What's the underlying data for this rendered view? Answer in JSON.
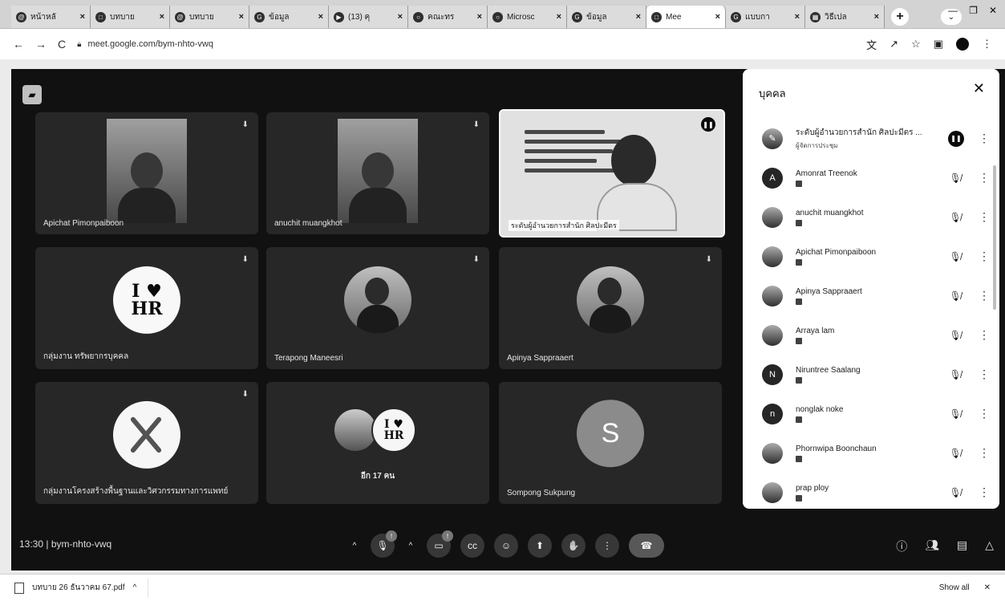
{
  "browser": {
    "tabs": [
      {
        "favicon": "@",
        "label": "หน้าหลั"
      },
      {
        "favicon": "□",
        "label": "บทบาย"
      },
      {
        "favicon": "@",
        "label": "บทบาย"
      },
      {
        "favicon": "G",
        "label": "ข้อมูล"
      },
      {
        "favicon": "▶",
        "label": "(13) คุ"
      },
      {
        "favicon": "○",
        "label": "คณะทร"
      },
      {
        "favicon": "○",
        "label": "Microsc"
      },
      {
        "favicon": "G",
        "label": "ข้อมูล"
      },
      {
        "favicon": "□",
        "label": "Mee"
      },
      {
        "favicon": "G",
        "label": "แบบกา"
      },
      {
        "favicon": "▦",
        "label": "วิธีเปล"
      }
    ],
    "url": "meet.google.com/bym-nhto-vwq"
  },
  "meet": {
    "tiles": [
      {
        "name": "Apichat Pimonpaiboon"
      },
      {
        "name": "anuchit muangkhot"
      },
      {
        "name": "ระดับผู้อำนวยการสำนัก ศิลปะมีตร"
      },
      {
        "name": "กลุ่มงาน ทรัพยากรบุคคล"
      },
      {
        "name": "Terapong Maneesri"
      },
      {
        "name": "Apinya Sappraaert"
      },
      {
        "name": "กลุ่มงานโครงสร้างพื้นฐานและวิศวกรรมทางการแพทย์"
      },
      {
        "name": "อีก 17 คน"
      },
      {
        "name": "Sompong Sukpung",
        "initial": "S"
      }
    ],
    "meeting_info": "13:30 | bym-nhto-vwq",
    "controls": {
      "mic_badge": "!",
      "cam_badge": "!"
    }
  },
  "people_panel": {
    "title": "บุคคล",
    "people": [
      {
        "name": "ระดับผู้อำนวยการสำนัก ศิลปะมีตร ...",
        "sub": "ผู้จัดการประชุม",
        "initial": ""
      },
      {
        "name": "Amonrat Treenok",
        "sub": "",
        "initial": "A"
      },
      {
        "name": "anuchit muangkhot",
        "sub": "",
        "initial": ""
      },
      {
        "name": "Apichat Pimonpaiboon",
        "sub": "",
        "initial": ""
      },
      {
        "name": "Apinya Sappraaert",
        "sub": "",
        "initial": ""
      },
      {
        "name": "Arraya lam",
        "sub": "",
        "initial": ""
      },
      {
        "name": "Niruntree Saalang",
        "sub": "",
        "initial": "N"
      },
      {
        "name": "nonglak noke",
        "sub": "",
        "initial": "n"
      },
      {
        "name": "Phornwipa Boonchaun",
        "sub": "",
        "initial": ""
      },
      {
        "name": "prap ploy",
        "sub": "",
        "initial": ""
      }
    ]
  },
  "download_bar": {
    "filename": "บทบาย 26 ธันวาคม 67.pdf",
    "show_all": "Show all"
  }
}
